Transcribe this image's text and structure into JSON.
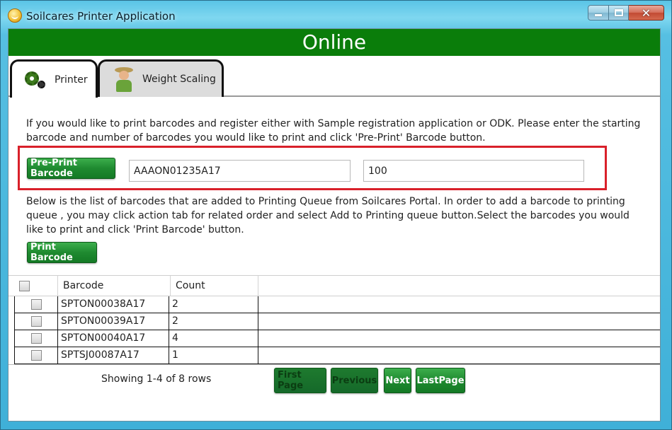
{
  "window": {
    "title": "Soilcares Printer Application"
  },
  "status": {
    "text": "Online",
    "color": "#0a7d0a"
  },
  "tabs": [
    {
      "label": "Printer",
      "icon": "gears-icon",
      "active": true
    },
    {
      "label": "Weight Scaling",
      "icon": "farmer-icon",
      "active": false
    }
  ],
  "preprint": {
    "instructions": "If you would like to print barcodes and register either with Sample registration application or ODK. Please enter the starting barcode and number of barcodes you would like to print and click 'Pre-Print' Barcode button.",
    "button_label": "Pre-Print Barcode",
    "start_barcode": "AAAON01235A17",
    "count": "100",
    "highlight_color": "#d9202a"
  },
  "queue": {
    "instructions": " Below is the list of barcodes that are added to Printing Queue from Soilcares Portal. In order to add a barcode to printing queue , you may click action tab for related order and select Add to Printing queue button.Select the barcodes you would like to print and click 'Print Barcode' button.",
    "print_button_label": "Print Barcode"
  },
  "table": {
    "columns": [
      "Barcode",
      "Count"
    ],
    "rows": [
      {
        "barcode": "SPTON00038A17",
        "count": "2"
      },
      {
        "barcode": "SPTON00039A17",
        "count": "2"
      },
      {
        "barcode": "SPTON00040A17",
        "count": "4"
      },
      {
        "barcode": "SPTSJ00087A17",
        "count": "1"
      }
    ]
  },
  "pager": {
    "summary": "Showing 1-4 of 8 rows",
    "first_label": "First Page",
    "previous_label": "Previous",
    "next_label": "Next",
    "last_label": "LastPage"
  }
}
